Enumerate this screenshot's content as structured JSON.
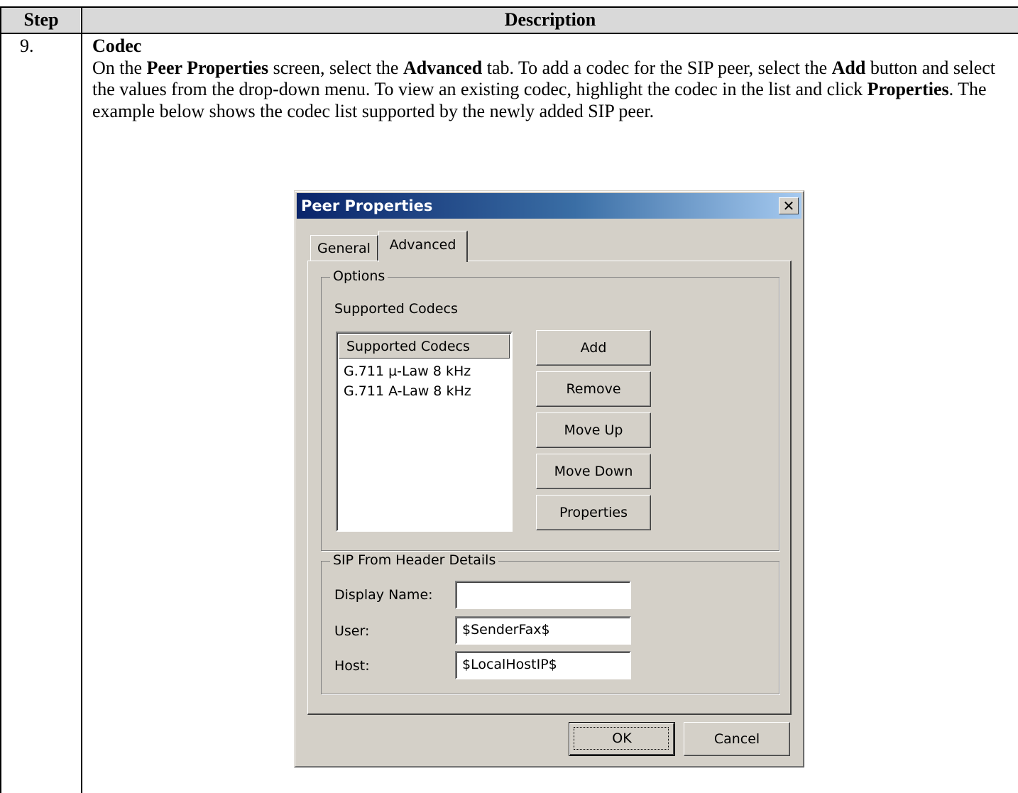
{
  "table": {
    "header_step": "Step",
    "header_description": "Description",
    "step_number": "9.",
    "heading": "Codec",
    "paragraph": [
      {
        "text": "On the ",
        "bold": false
      },
      {
        "text": "Peer Properties",
        "bold": true
      },
      {
        "text": " screen, select the ",
        "bold": false
      },
      {
        "text": "Advanced",
        "bold": true
      },
      {
        "text": " tab. To add a codec for the SIP peer, select the ",
        "bold": false
      },
      {
        "text": "Add",
        "bold": true
      },
      {
        "text": " button and select the values from the drop-down menu.  To view an existing codec, highlight the codec in the list and click ",
        "bold": false
      },
      {
        "text": "Properties",
        "bold": true
      },
      {
        "text": ".  The example below shows the codec list supported by the newly added SIP peer.",
        "bold": false
      }
    ]
  },
  "dialog": {
    "title": "Peer Properties",
    "close_glyph": "✕",
    "tabs": [
      "General",
      "Advanced"
    ],
    "active_tab": "Advanced",
    "options_group": {
      "legend": "Options",
      "label": "Supported Codecs",
      "list_header": "Supported Codecs",
      "codecs": [
        "G.711 µ-Law 8 kHz",
        "G.711 A-Law 8 kHz"
      ],
      "buttons": [
        "Add",
        "Remove",
        "Move Up",
        "Move Down",
        "Properties"
      ]
    },
    "sip_group": {
      "legend": "SIP From Header Details",
      "display_name_label": "Display Name:",
      "display_name_value": "",
      "user_label": "User:",
      "user_value": "$SenderFax$",
      "host_label": "Host:",
      "host_value": "$LocalHostIP$"
    },
    "ok_label": "OK",
    "cancel_label": "Cancel"
  }
}
